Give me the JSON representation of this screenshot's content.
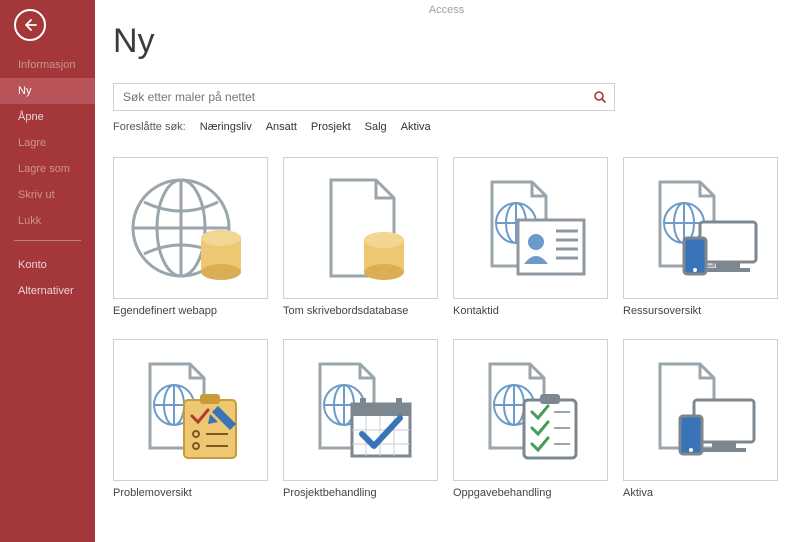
{
  "app_title": "Access",
  "page_title": "Ny",
  "sidebar": {
    "items": [
      {
        "label": "Informasjon",
        "state": "disabled"
      },
      {
        "label": "Ny",
        "state": "active"
      },
      {
        "label": "Åpne",
        "state": "normal"
      },
      {
        "label": "Lagre",
        "state": "disabled"
      },
      {
        "label": "Lagre som",
        "state": "disabled"
      },
      {
        "label": "Skriv ut",
        "state": "disabled"
      },
      {
        "label": "Lukk",
        "state": "disabled"
      }
    ],
    "bottom_items": [
      {
        "label": "Konto"
      },
      {
        "label": "Alternativer"
      }
    ]
  },
  "search": {
    "placeholder": "Søk etter maler på nettet"
  },
  "suggested": {
    "label": "Foreslåtte søk:",
    "links": [
      "Næringsliv",
      "Ansatt",
      "Prosjekt",
      "Salg",
      "Aktiva"
    ]
  },
  "templates": [
    {
      "label": "Egendefinert webapp",
      "icon": "globe-db"
    },
    {
      "label": "Tom skrivebordsdatabase",
      "icon": "doc-db"
    },
    {
      "label": "Kontaktid",
      "icon": "contacts"
    },
    {
      "label": "Ressursoversikt",
      "icon": "resources"
    },
    {
      "label": "Problemoversikt",
      "icon": "problems"
    },
    {
      "label": "Prosjektbehandling",
      "icon": "project"
    },
    {
      "label": "Oppgavebehandling",
      "icon": "tasks"
    },
    {
      "label": "Aktiva",
      "icon": "assets"
    }
  ]
}
